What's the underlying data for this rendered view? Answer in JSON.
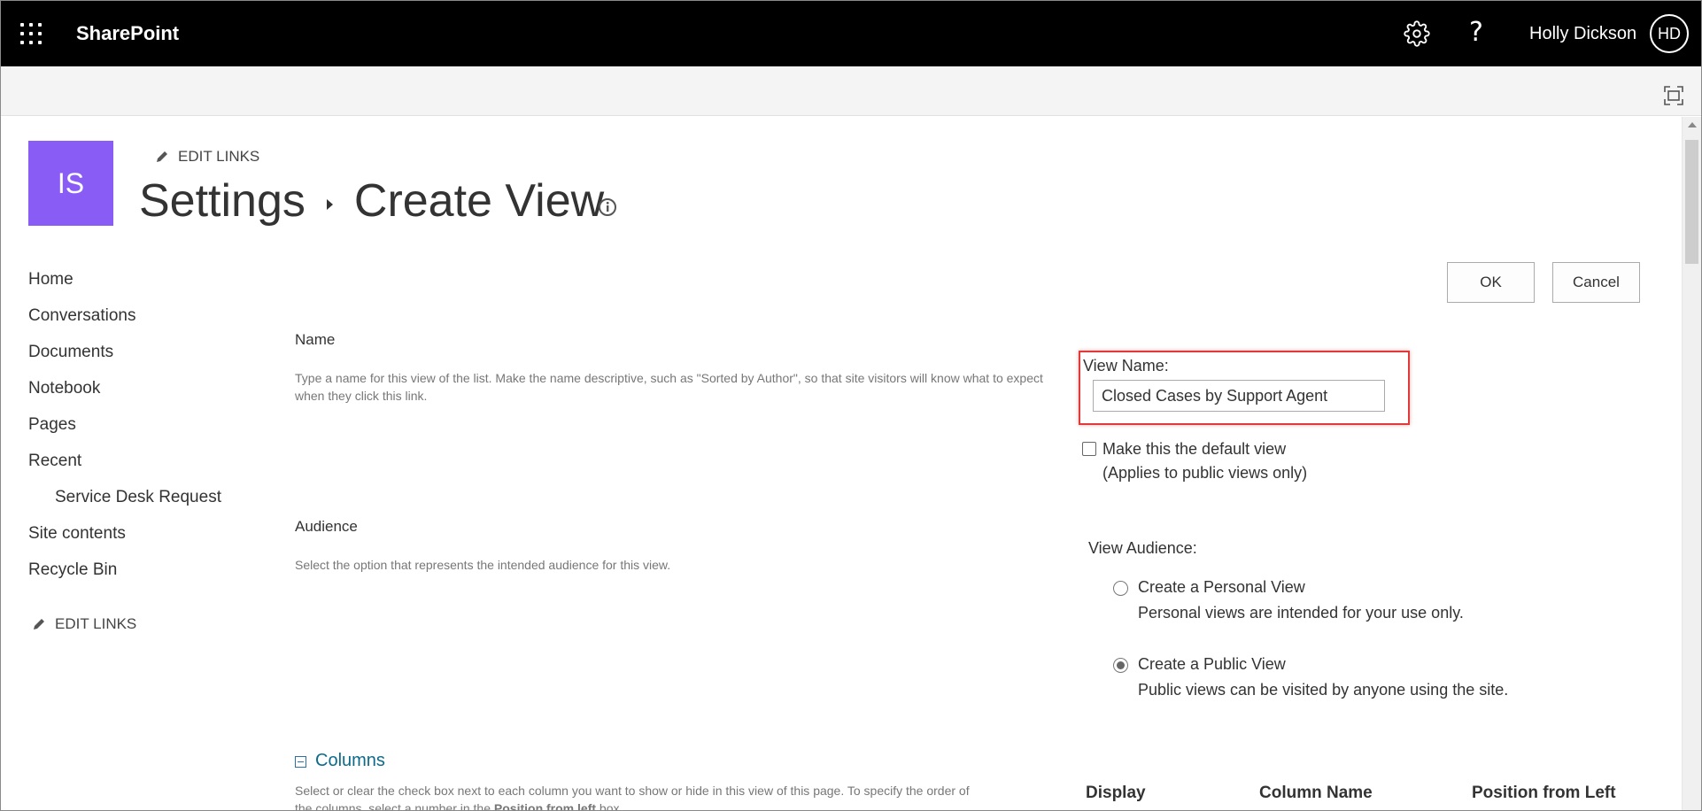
{
  "suite_bar": {
    "brand": "SharePoint",
    "user_name": "Holly Dickson",
    "user_initials": "HD",
    "help_glyph": "?",
    "icons": [
      "app-launcher-icon",
      "gear-icon",
      "help-icon",
      "focus-mode-icon"
    ]
  },
  "site": {
    "logo_initials": "IS",
    "logo_color": "#8a5cf6",
    "edit_links": "EDIT LINKS"
  },
  "page": {
    "breadcrumb_parent": "Settings",
    "breadcrumb_current": "Create View"
  },
  "nav": {
    "items": [
      {
        "label": "Home"
      },
      {
        "label": "Conversations"
      },
      {
        "label": "Documents"
      },
      {
        "label": "Notebook"
      },
      {
        "label": "Pages"
      },
      {
        "label": "Recent"
      },
      {
        "label": "Service Desk Request"
      },
      {
        "label": "Site contents"
      },
      {
        "label": "Recycle Bin"
      }
    ],
    "edit_links": "EDIT LINKS"
  },
  "actions": {
    "ok": "OK",
    "cancel": "Cancel"
  },
  "name_section": {
    "title": "Name",
    "description": "Type a name for this view of the list. Make the name descriptive, such as \"Sorted by Author\", so that site visitors will know what to expect when they click this link.",
    "view_name_label": "View Name:",
    "view_name_value": "Closed Cases by Support Agent",
    "default_view_label": "Make this the default view",
    "default_view_note": "(Applies to public views only)",
    "default_view_checked": false
  },
  "audience_section": {
    "title": "Audience",
    "description": "Select the option that represents the intended audience for this view.",
    "view_audience_label": "View Audience:",
    "options": [
      {
        "label": "Create a Personal View",
        "description": "Personal views are intended for your use only.",
        "checked": false
      },
      {
        "label": "Create a Public View",
        "description": "Public views can be visited by anyone using the site.",
        "checked": true
      }
    ]
  },
  "columns_section": {
    "title": "Columns",
    "description_line1": "Select or clear the check box next to each column you want to show or hide in this view of this page. To specify the order of",
    "description_line2_prefix": "the columns, select a number in the ",
    "description_line2_bold": "Position from left",
    "description_line2_suffix": " box.",
    "headers": [
      "Display",
      "Column Name",
      "Position from Left"
    ]
  }
}
